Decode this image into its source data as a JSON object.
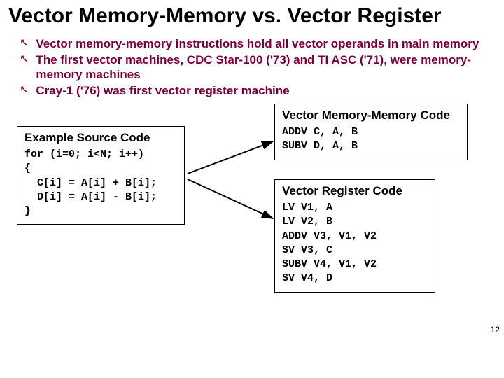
{
  "title": "Vector Memory-Memory vs. Vector Register",
  "bullets": [
    "Vector memory-memory instructions hold all vector operands in main memory",
    "The first vector machines, CDC Star-100 ('73) and TI ASC ('71), were memory-memory machines",
    "Cray-1 ('76) was first vector register machine"
  ],
  "source": {
    "title": "Example Source Code",
    "code": "for (i=0; i<N; i++)\n{\n  C[i] = A[i] + B[i];\n  D[i] = A[i] - B[i];\n}"
  },
  "mm": {
    "title": "Vector Memory-Memory Code",
    "code": "ADDV C, A, B\nSUBV D, A, B"
  },
  "reg": {
    "title": "Vector Register Code",
    "code": "LV V1, A\nLV V2, B\nADDV V3, V1, V2\nSV V3, C\nSUBV V4, V1, V2\nSV V4, D"
  },
  "pagenum": "12"
}
